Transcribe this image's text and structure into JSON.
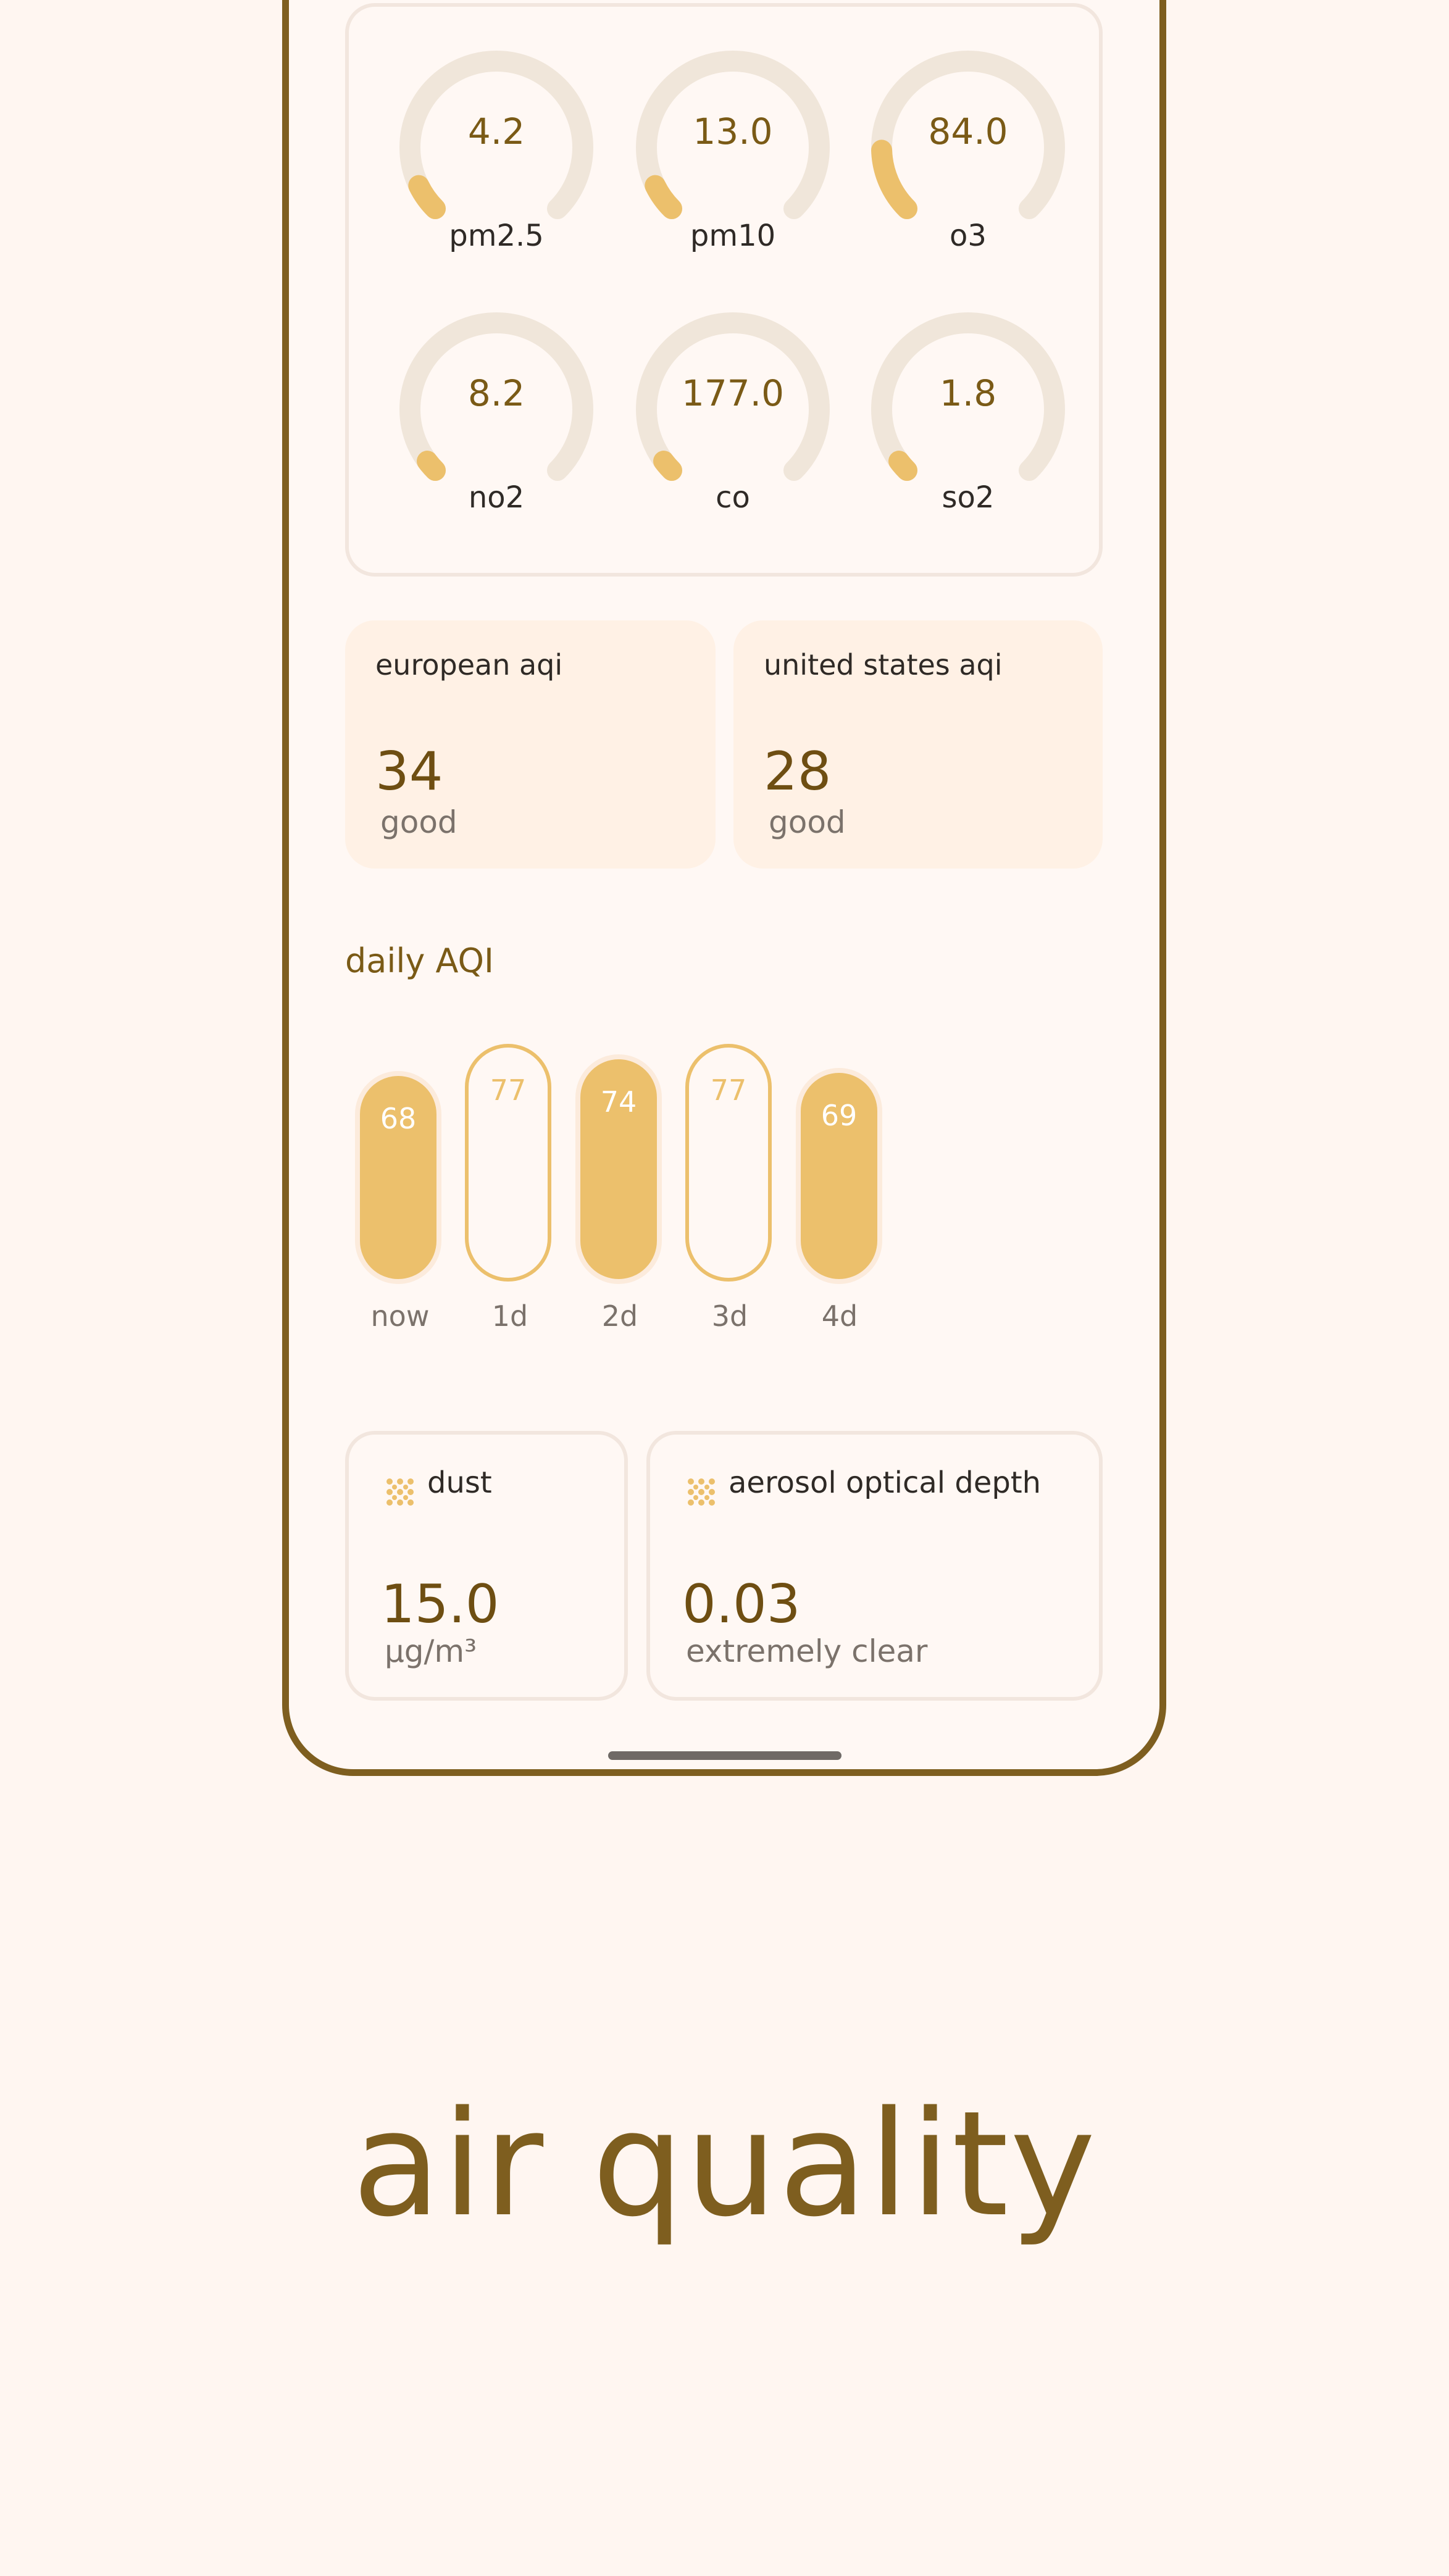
{
  "pollutants": [
    {
      "value": "4.2",
      "label": "pm2.5",
      "level": 0.07
    },
    {
      "value": "13.0",
      "label": "pm10",
      "level": 0.07
    },
    {
      "value": "84.0",
      "label": "o3",
      "level": 0.16
    },
    {
      "value": "8.2",
      "label": "no2",
      "level": 0.03
    },
    {
      "value": "177.0",
      "label": "co",
      "level": 0.03
    },
    {
      "value": "1.8",
      "label": "so2",
      "level": 0.03
    }
  ],
  "aqi": [
    {
      "title": "european aqi",
      "value": "34",
      "status": "good"
    },
    {
      "title": "united states aqi",
      "value": "28",
      "status": "good"
    }
  ],
  "daily": {
    "title": "daily AQI",
    "items": [
      {
        "value": "68",
        "label": "now",
        "style": "filled"
      },
      {
        "value": "77",
        "label": "1d",
        "style": "outline"
      },
      {
        "value": "74",
        "label": "2d",
        "style": "filled"
      },
      {
        "value": "77",
        "label": "3d",
        "style": "outline"
      },
      {
        "value": "69",
        "label": "4d",
        "style": "filled"
      }
    ]
  },
  "environment": [
    {
      "title": "dust",
      "value": "15.0",
      "sub": "µg/m³",
      "icon": "dust-icon"
    },
    {
      "title": "aerosol optical depth",
      "value": "0.03",
      "sub": "extremely clear",
      "icon": "aerosol-icon"
    }
  ],
  "headline": "air quality",
  "colors": {
    "accent": "#ECC06C",
    "track": "#F0E6DA",
    "value_text": "#7A5A16",
    "frame": "#7E5E1F",
    "background": "#FFF6F1"
  }
}
